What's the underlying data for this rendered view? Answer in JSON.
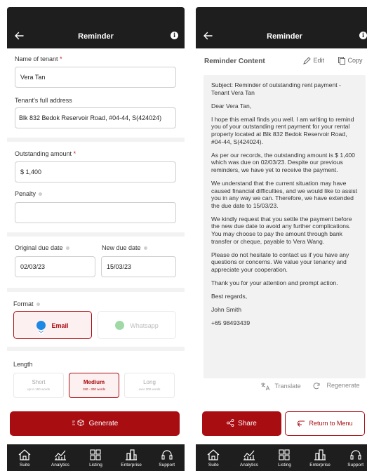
{
  "form": {
    "title": "Reminder",
    "tenant_name_label": "Name of tenant",
    "tenant_name_value": "Vera Tan",
    "address_label": "Tenant's full address",
    "address_value": "Blk 832 Bedok Reservoir Road, #04-44, S(424024)",
    "outstanding_label": "Outstanding amount",
    "outstanding_value": "$ 1,400",
    "penalty_label": "Penalty",
    "penalty_value": "",
    "original_due_label": "Original due date",
    "original_due_value": "02/03/23",
    "new_due_label": "New due date",
    "new_due_value": "15/03/23",
    "format_label": "Format",
    "format_options": [
      "Email",
      "Whatsapp"
    ],
    "format_selected": "Email",
    "length_label": "Length",
    "length_options": [
      {
        "name": "Short",
        "sub": "up to 150 words"
      },
      {
        "name": "Medium",
        "sub": "150 - 300 words"
      },
      {
        "name": "Long",
        "sub": "over 300 words"
      }
    ],
    "length_selected": "Medium",
    "generate_label": "Generate"
  },
  "result": {
    "title": "Reminder",
    "section_title": "Reminder Content",
    "edit_label": "Edit",
    "copy_label": "Copy",
    "paragraphs": [
      "Subject: Reminder of outstanding rent payment - Tenant Vera Tan",
      "Dear Vera Tan,",
      "I hope this email finds you well. I am writing to remind you of your outstanding rent payment for your rental property located at Blk 832 Bedok Reservoir Road, #04-44, S(424024).",
      "As per our records, the outstanding amount is $ 1,400 which was due on 02/03/23. Despite our previous reminders, we have yet to receive the payment.",
      "We understand that the current situation may have caused financial difficulties, and we would like to assist you in any way we can. Therefore, we have extended the due date to 15/03/23.",
      "We kindly request that you settle the payment before the new due date to avoid any further complications. You may choose to pay the amount through bank transfer or cheque, payable to Vera Wang.",
      "Please do not hesitate to contact us if you have any questions or concerns. We value your tenancy and appreciate your cooperation.",
      "Thank you for your attention and prompt action.",
      "Best regards,",
      "John Smith",
      "+65 98493439"
    ],
    "translate_label": "Translate",
    "regenerate_label": "Regenerate",
    "share_label": "Share",
    "return_label": "Return to Menu"
  },
  "nav": {
    "items": [
      {
        "label": "Suite",
        "icon": "house-icon"
      },
      {
        "label": "Analytics",
        "icon": "analytics-icon"
      },
      {
        "label": "Listing",
        "icon": "grid-icon"
      },
      {
        "label": "Enterprise",
        "icon": "buildings-icon"
      },
      {
        "label": "Support",
        "icon": "headset-icon"
      }
    ]
  },
  "colors": {
    "brand": "#a80d12",
    "topbar": "#1e1e1e",
    "email_icon": "#1e88e5",
    "whatsapp_icon": "#9fd9a5"
  }
}
